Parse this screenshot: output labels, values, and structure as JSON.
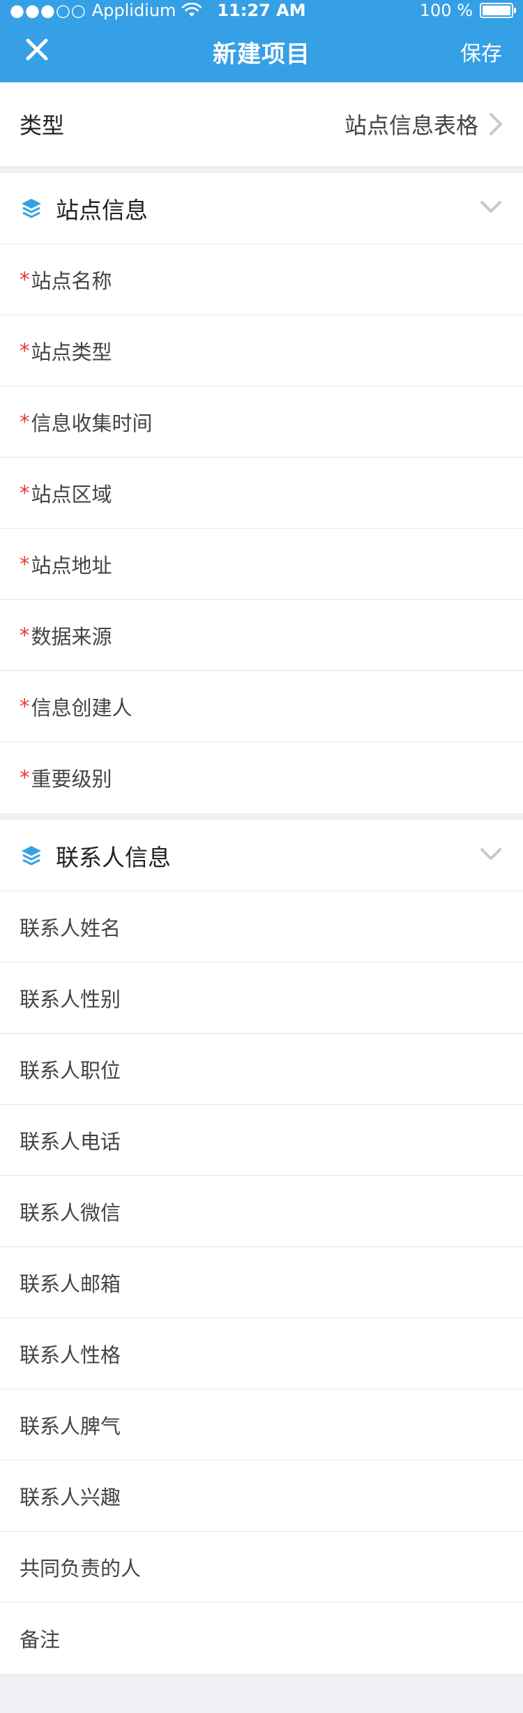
{
  "status_bar": {
    "signal": "●●●○○",
    "carrier": "Applidium",
    "time": "11:27 AM",
    "battery": "100 %"
  },
  "nav": {
    "close_icon": "close-icon",
    "title": "新建项目",
    "save_label": "保存"
  },
  "type_row": {
    "label": "类型",
    "value": "站点信息表格"
  },
  "sections": [
    {
      "title": "站点信息",
      "fields": [
        {
          "label": "站点名称",
          "required": true
        },
        {
          "label": "站点类型",
          "required": true
        },
        {
          "label": "信息收集时间",
          "required": true
        },
        {
          "label": "站点区域",
          "required": true
        },
        {
          "label": "站点地址",
          "required": true
        },
        {
          "label": "数据来源",
          "required": true
        },
        {
          "label": "信息创建人",
          "required": true
        },
        {
          "label": "重要级别",
          "required": true
        }
      ]
    },
    {
      "title": "联系人信息",
      "fields": [
        {
          "label": "联系人姓名",
          "required": false
        },
        {
          "label": "联系人性别",
          "required": false
        },
        {
          "label": "联系人职位",
          "required": false
        },
        {
          "label": "联系人电话",
          "required": false
        },
        {
          "label": "联系人微信",
          "required": false
        },
        {
          "label": "联系人邮箱",
          "required": false
        },
        {
          "label": "联系人性格",
          "required": false
        },
        {
          "label": "联系人脾气",
          "required": false
        },
        {
          "label": "联系人兴趣",
          "required": false
        },
        {
          "label": "共同负责的人",
          "required": false
        },
        {
          "label": "备注",
          "required": false
        }
      ]
    }
  ],
  "required_mark": "*",
  "colors": {
    "accent": "#35a0e5",
    "required": "#e53935",
    "background": "#efeff4"
  }
}
